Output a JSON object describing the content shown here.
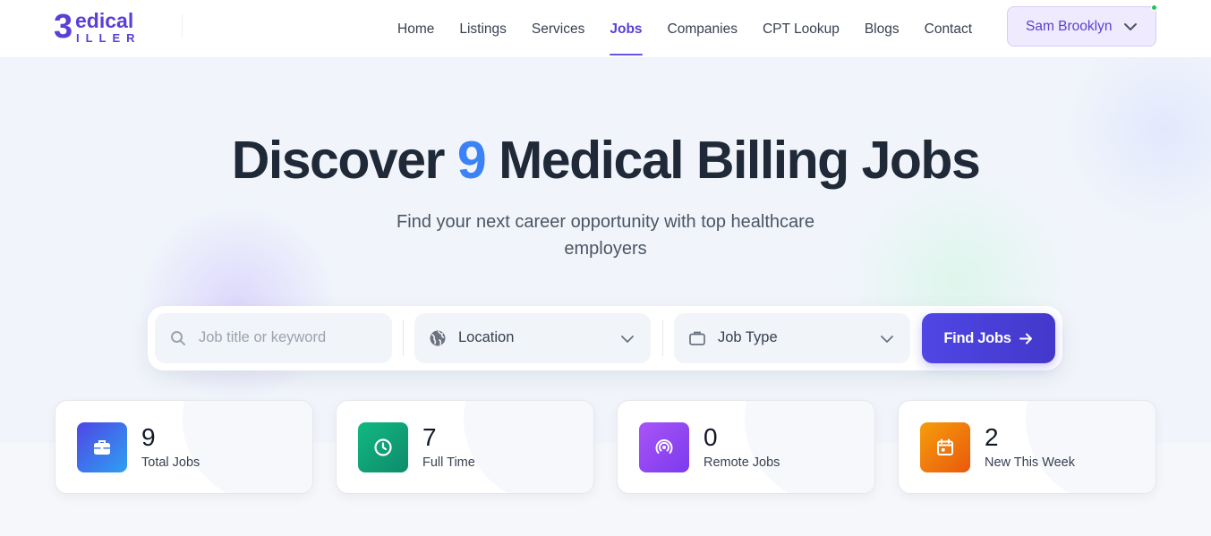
{
  "brand": {
    "logo_text_top": "edical",
    "logo_text_bottom": "ILLER",
    "logo_letter": "B"
  },
  "nav": {
    "items": [
      {
        "label": "Home",
        "active": false
      },
      {
        "label": "Listings",
        "active": false
      },
      {
        "label": "Services",
        "active": false
      },
      {
        "label": "Jobs",
        "active": true
      },
      {
        "label": "Companies",
        "active": false
      },
      {
        "label": "CPT Lookup",
        "active": false
      },
      {
        "label": "Blogs",
        "active": false
      },
      {
        "label": "Contact",
        "active": false
      }
    ],
    "user_name": "Sam Brooklyn"
  },
  "hero": {
    "title_prefix": "Discover",
    "title_count": "9",
    "title_suffix": "Medical Billing Jobs",
    "subtitle": "Find your next career opportunity with top healthcare employers"
  },
  "search": {
    "keyword_placeholder": "Job title or keyword",
    "location_label": "Location",
    "job_type_label": "Job Type",
    "submit_label": "Find Jobs"
  },
  "stats": [
    {
      "value": "9",
      "label": "Total Jobs",
      "icon": "briefcase-icon",
      "color_from": "#4f46e5",
      "color_to": "#2ea0f2"
    },
    {
      "value": "7",
      "label": "Full Time",
      "icon": "clock-icon",
      "color_from": "#10b981",
      "color_to": "#0f8a6b"
    },
    {
      "value": "0",
      "label": "Remote Jobs",
      "icon": "broadcast-icon",
      "color_from": "#a855f7",
      "color_to": "#7c3aed"
    },
    {
      "value": "2",
      "label": "New This Week",
      "icon": "calendar-icon",
      "color_from": "#f59e0b",
      "color_to": "#ea580c"
    }
  ],
  "colors": {
    "accent": "#5b3fd6",
    "highlight_number": "#3b82f6",
    "online": "#22c55e"
  }
}
